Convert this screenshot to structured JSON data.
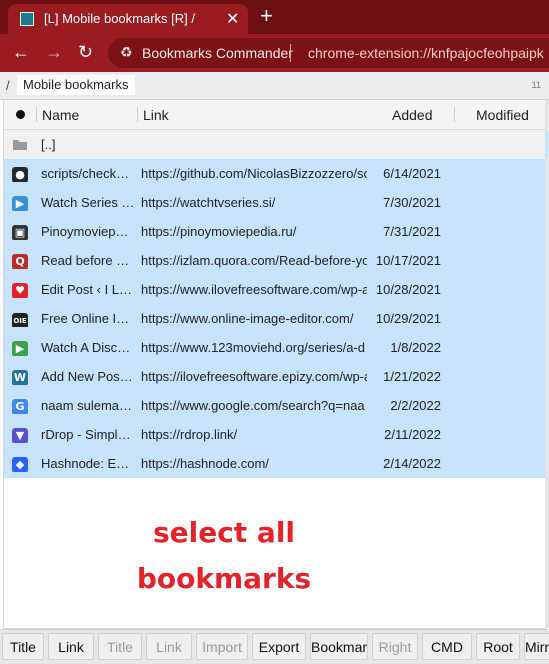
{
  "browser": {
    "tab_title": "[L] Mobile bookmarks [R] /",
    "tab_close": "✕",
    "new_tab": "+",
    "extension_name": "Bookmarks Commander",
    "url": "chrome-extension://knfpajocfeohpaipk"
  },
  "path": {
    "slash": "/",
    "chip": "Mobile bookmarks",
    "count": "11"
  },
  "columns": {
    "name": "Name",
    "link": "Link",
    "added": "Added",
    "modified": "Modified"
  },
  "parent_row": {
    "name": "[..]"
  },
  "rows": [
    {
      "name": "scripts/check…",
      "link": "https://github.com/NicolasBizzozzero/sc",
      "added": "6/14/2021",
      "icon": "github-icon",
      "icon_glyph": "●",
      "icon_color": "#24292e"
    },
    {
      "name": "Watch Series …",
      "link": "https://watchtvseries.si/",
      "added": "7/30/2021",
      "icon": "play-icon",
      "icon_glyph": "▶",
      "icon_color": "#3a8fd6"
    },
    {
      "name": "Pinoymoviepe…",
      "link": "https://pinoymoviepedia.ru/",
      "added": "7/31/2021",
      "icon": "tv-icon",
      "icon_glyph": "▣",
      "icon_color": "#333333"
    },
    {
      "name": "Read before y…",
      "link": "https://izlam.quora.com/Read-before-yo",
      "added": "10/17/2021",
      "icon": "quora-icon",
      "icon_glyph": "Q",
      "icon_color": "#b92b27"
    },
    {
      "name": "Edit Post ‹ I L…",
      "link": "https://www.ilovefreesoftware.com/wp-a",
      "added": "10/28/2021",
      "icon": "heart-icon",
      "icon_glyph": "♥",
      "icon_color": "#e0202a"
    },
    {
      "name": "Free Online I…",
      "link": "https://www.online-image-editor.com/",
      "added": "10/29/2021",
      "icon": "oie-icon",
      "icon_glyph": "OIE",
      "icon_color": "#222222"
    },
    {
      "name": "Watch A Disc…",
      "link": "https://www.123moviehd.org/series/a-d",
      "added": "1/8/2022",
      "icon": "play-circle-icon",
      "icon_glyph": "▶",
      "icon_color": "#3aa14a"
    },
    {
      "name": "Add New Pos…",
      "link": "https://ilovefreesoftware.epizy.com/wp-a",
      "added": "1/21/2022",
      "icon": "wordpress-icon",
      "icon_glyph": "W",
      "icon_color": "#21759b"
    },
    {
      "name": "naam sulema…",
      "link": "https://www.google.com/search?q=naa",
      "added": "2/2/2022",
      "icon": "google-icon",
      "icon_glyph": "G",
      "icon_color": "#4285f4"
    },
    {
      "name": "rDrop - Simpl…",
      "link": "https://rdrop.link/",
      "added": "2/11/2022",
      "icon": "rdrop-icon",
      "icon_glyph": "▼",
      "icon_color": "#5a4fcf"
    },
    {
      "name": "Hashnode: Ev…",
      "link": "https://hashnode.com/",
      "added": "2/14/2022",
      "icon": "hashnode-icon",
      "icon_glyph": "◆",
      "icon_color": "#2962ff"
    }
  ],
  "annotation": {
    "line1": "select all",
    "line2": "bookmarks"
  },
  "bottom_buttons": [
    {
      "label": "Title",
      "disabled": false
    },
    {
      "label": "Link",
      "disabled": false
    },
    {
      "label": "Title",
      "disabled": true
    },
    {
      "label": "Link",
      "disabled": true
    },
    {
      "label": "Import",
      "disabled": true
    },
    {
      "label": "Export",
      "disabled": false
    },
    {
      "label": "Bookmark",
      "disabled": false
    },
    {
      "label": "Right",
      "disabled": true
    },
    {
      "label": "CMD",
      "disabled": false
    },
    {
      "label": "Root",
      "disabled": false
    },
    {
      "label": "Mirror",
      "disabled": false
    }
  ]
}
